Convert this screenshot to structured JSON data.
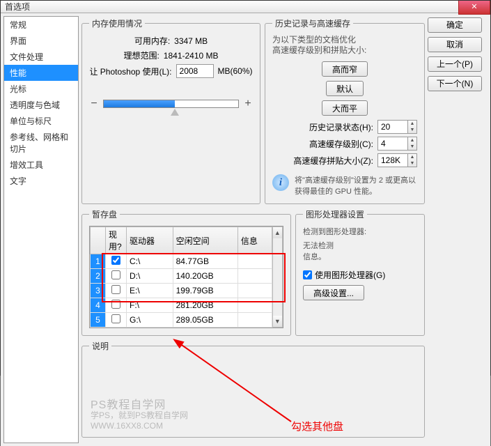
{
  "window": {
    "title": "首选项"
  },
  "sidebar": {
    "items": [
      "常规",
      "界面",
      "文件处理",
      "性能",
      "光标",
      "透明度与色域",
      "单位与标尺",
      "参考线、网格和切片",
      "增效工具",
      "文字"
    ],
    "active_index": 3
  },
  "buttons": {
    "ok": "确定",
    "cancel": "取消",
    "prev": "上一个(P)",
    "next": "下一个(N)"
  },
  "memory": {
    "legend": "内存使用情况",
    "available_label": "可用内存:",
    "available_value": "3347 MB",
    "ideal_label": "理想范围:",
    "ideal_value": "1841-2410 MB",
    "let_label": "让 Photoshop 使用(L):",
    "let_value": "2008",
    "let_unit": "MB(60%)",
    "minus": "−",
    "plus": "+"
  },
  "history": {
    "legend": "历史记录与高速缓存",
    "note1": "为以下类型的文档优化",
    "note2": "高速缓存级别和拼贴大小:",
    "btn_tall": "高而窄",
    "btn_default": "默认",
    "btn_wide": "大而平",
    "states_label": "历史记录状态(H):",
    "states_value": "20",
    "cache_label": "高速缓存级别(C):",
    "cache_value": "4",
    "tile_label": "高速缓存拼贴大小(Z):",
    "tile_value": "128K",
    "info_text": "将\"高速缓存级别\"设置为 2 或更高以获得最佳的 GPU 性能。"
  },
  "scratch": {
    "legend": "暂存盘",
    "col_active": "现用?",
    "col_drive": "驱动器",
    "col_free": "空闲空间",
    "col_info": "信息",
    "rows": [
      {
        "n": "1",
        "active": true,
        "drive": "C:\\",
        "free": "84.77GB",
        "info": ""
      },
      {
        "n": "2",
        "active": false,
        "drive": "D:\\",
        "free": "140.20GB",
        "info": ""
      },
      {
        "n": "3",
        "active": false,
        "drive": "E:\\",
        "free": "199.79GB",
        "info": ""
      },
      {
        "n": "4",
        "active": false,
        "drive": "F:\\",
        "free": "281.20GB",
        "info": ""
      },
      {
        "n": "5",
        "active": false,
        "drive": "G:\\",
        "free": "289.05GB",
        "info": ""
      }
    ]
  },
  "gpu": {
    "legend": "图形处理器设置",
    "detect_label": "检测到图形处理器:",
    "detect_value": "无法检测\n信息。",
    "use_gpu": "使用图形处理器(G)",
    "advanced": "高级设置..."
  },
  "desc": {
    "legend": "说明",
    "watermark_big": "PS教程自学网",
    "watermark_l1": "学PS，就到PS教程自学网",
    "watermark_l2": "WWW.16XX8.COM",
    "annotation": "勾选其他盘"
  }
}
